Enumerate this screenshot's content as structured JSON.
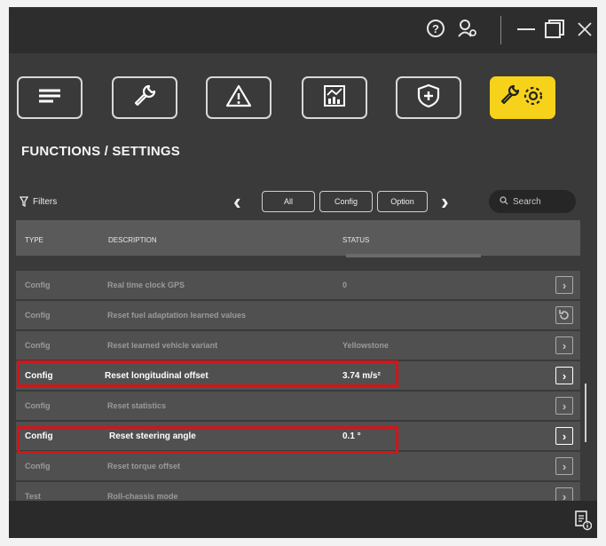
{
  "titlebar": {
    "icons": [
      "help-icon",
      "user-settings-icon",
      "minimize-icon",
      "maximize-icon",
      "close-icon"
    ]
  },
  "toolbar": {
    "buttons": [
      {
        "name": "menu-icon"
      },
      {
        "name": "wrench-icon"
      },
      {
        "name": "warning-icon"
      },
      {
        "name": "chart-icon"
      },
      {
        "name": "shield-plus-icon"
      },
      {
        "name": "wrench-gear-icon",
        "active": true
      }
    ],
    "active_color": "#f7d21a"
  },
  "page": {
    "title": "FUNCTIONS / SETTINGS"
  },
  "filters": {
    "label": "Filters",
    "options": [
      "All",
      "Config",
      "Option"
    ],
    "search_placeholder": "Search"
  },
  "table": {
    "columns": [
      "TYPE",
      "DESCRIPTION",
      "STATUS"
    ],
    "rows": [
      {
        "type": "Config",
        "description": "Real time clock GPS",
        "status": "0",
        "action": "chevron"
      },
      {
        "type": "Config",
        "description": "Reset fuel adaptation learned values",
        "status": "",
        "action": "reset"
      },
      {
        "type": "Config",
        "description": "Reset learned vehicle variant",
        "status": "Yellowstone",
        "action": "chevron"
      },
      {
        "type": "Config",
        "description": "Reset longitudinal offset",
        "status": "3.74 m/s²",
        "action": "chevron",
        "highlighted": true
      },
      {
        "type": "Config",
        "description": "Reset statistics",
        "status": "",
        "action": "chevron"
      },
      {
        "type": "Config",
        "description": "Reset steering angle",
        "status": "0.1 °",
        "action": "chevron",
        "highlighted": true
      },
      {
        "type": "Config",
        "description": "Reset torque offset",
        "status": "",
        "action": "chevron"
      },
      {
        "type": "Test",
        "description": "Roll-chassis mode",
        "status": "",
        "action": "chevron"
      }
    ]
  },
  "colors": {
    "highlight_border": "#d0161a"
  }
}
